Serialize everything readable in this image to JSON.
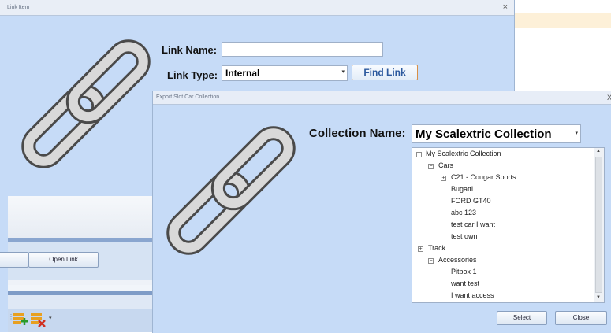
{
  "link_item_dialog": {
    "title": "Link Item",
    "close_glyph": "×",
    "link_name_label": "Link Name:",
    "link_name_value": "",
    "link_type_label": "Link Type:",
    "link_type_value": "Internal",
    "find_link_label": "Find Link",
    "open_link_label": "Open Link"
  },
  "export_dialog": {
    "title": "Export Slot Car Collection",
    "close_glyph": "X",
    "collection_name_label": "Collection Name:",
    "collection_name_value": "My Scalextric Collection",
    "select_label": "Select",
    "close_label": "Close",
    "tree": [
      {
        "label": "My Scalextric Collection",
        "toggle": "⊟"
      },
      {
        "label": "Cars",
        "toggle": "⊟"
      },
      {
        "label": "C21 - Cougar Sports",
        "toggle": "⊞"
      },
      {
        "label": "Bugatti",
        "toggle": ""
      },
      {
        "label": "FORD GT40",
        "toggle": ""
      },
      {
        "label": "abc 123",
        "toggle": ""
      },
      {
        "label": "test car I want",
        "toggle": ""
      },
      {
        "label": "test own",
        "toggle": ""
      },
      {
        "label": "Track",
        "toggle": "⊞"
      },
      {
        "label": "Accessories",
        "toggle": "⊟"
      },
      {
        "label": "Pitbox 1",
        "toggle": ""
      },
      {
        "label": "want test",
        "toggle": ""
      },
      {
        "label": "I want access",
        "toggle": ""
      }
    ]
  },
  "icons": {
    "chain": "link-chain-icon",
    "add": "add-row-icon",
    "delete": "delete-row-icon"
  }
}
